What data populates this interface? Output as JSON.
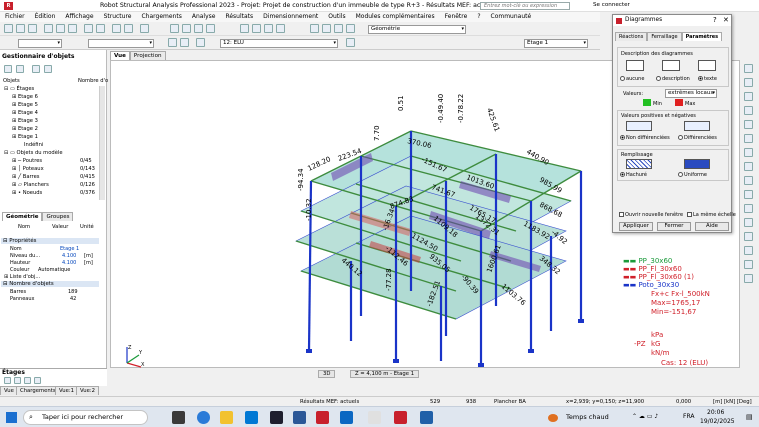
{
  "window": {
    "title": "Robot Structural Analysis Professional 2023 - Projet: Projet de construction d'un immeuble de type R+3 - Résultats MEF: actuels",
    "search_placeholder": "Entrez mot-clé ou expression",
    "sign_in": "Se connecter"
  },
  "menu": [
    "Fichier",
    "Édition",
    "Affichage",
    "Structure",
    "Chargements",
    "Analyse",
    "Résultats",
    "Dimensionnement",
    "Outils",
    "Modules complémentaires",
    "Fenêtre",
    "?",
    "Communauté"
  ],
  "toolbar": {
    "load_case": "12: ELU",
    "layout": "Géométrie",
    "story": "Etage 1"
  },
  "object_inspector": {
    "title": "Gestionnaire d'objets",
    "col_objects": "Objets",
    "col_count": "Nombre d'o",
    "tree": [
      {
        "label": "Étages",
        "value": ""
      },
      {
        "label": "Etage 6",
        "value": ""
      },
      {
        "label": "Etage 5",
        "value": ""
      },
      {
        "label": "Etage 4",
        "value": ""
      },
      {
        "label": "Etage 3",
        "value": ""
      },
      {
        "label": "Etage 2",
        "value": ""
      },
      {
        "label": "Etage 1",
        "value": ""
      },
      {
        "label": "Indéfini",
        "value": ""
      },
      {
        "label": "Objets du modèle",
        "value": ""
      },
      {
        "label": "Poutres",
        "value": "0/45"
      },
      {
        "label": "Poteaux",
        "value": "0/143"
      },
      {
        "label": "Barres",
        "value": "0/415"
      },
      {
        "label": "Planchers",
        "value": "0/126"
      },
      {
        "label": "Noeuds",
        "value": "0/376"
      }
    ]
  },
  "properties": {
    "tabs": [
      "Géométrie",
      "Groupes"
    ],
    "headers": [
      "Nom",
      "Valeur",
      "Unité"
    ],
    "section_props": "Propriétés",
    "rows": [
      {
        "name": "Nom",
        "value": "Etage 1",
        "unit": ""
      },
      {
        "name": "Niveau du...",
        "value": "4.100",
        "unit": "[m]"
      },
      {
        "name": "Hauteur",
        "value": "4.100",
        "unit": "[m]"
      },
      {
        "name": "Couleur",
        "value": "Automatique",
        "unit": ""
      },
      {
        "name": "Liste d'obj...",
        "value": "",
        "unit": ""
      }
    ],
    "section_count": "Nombre d'objets",
    "count_rows": [
      {
        "name": "Barres",
        "value": "189"
      },
      {
        "name": "Panneaux",
        "value": "42"
      }
    ]
  },
  "etages_panel": "Étages",
  "view_tabs": [
    "Vue",
    "Projection"
  ],
  "diagram_labels": [
    "0.51",
    "-0.49.40",
    "-0.78.22",
    "7.70",
    "370.06",
    "425.61",
    "-151.67",
    "1013.60",
    "440.90",
    "223.54",
    "1765.17",
    "985.99",
    "128.20",
    "741.67",
    "874.83",
    "868.68",
    "-10.32",
    "1109.18",
    "1372.31",
    "-16.34",
    "1124.50",
    "1183.92",
    "-112.46",
    "935.05",
    "1600.61",
    "348.32",
    "440.12",
    "-94.34",
    "-77.28",
    "-182.51",
    "-90.39",
    "1103.76",
    "-4.92"
  ],
  "legend": {
    "items": [
      {
        "label": "PP_30x60",
        "color": "#1a9a3a"
      },
      {
        "label": "PP_Fl_30x60",
        "color": "#d0202a"
      },
      {
        "label": "PP_Fl_30x60 (1)",
        "color": "#d0202a"
      },
      {
        "label": "Poto_30x30",
        "color": "#1a34c8"
      }
    ],
    "diagram": "Fx+c Fx-l_500kN",
    "max": "Max=1765,17",
    "min": "Min=-151,67",
    "units": [
      "kPa",
      "kG",
      "kN/m"
    ],
    "pz": "-PZ",
    "case": "Cas: 12 (ELU)"
  },
  "viewport_bottom": {
    "mode": "3D",
    "level": "Z = 4,100 m - Etage 1"
  },
  "dialog": {
    "title": "Diagrammes",
    "tabs": [
      "Réactions",
      "Ferraillage",
      "Paramètres"
    ],
    "group_desc": "Description des diagrammes",
    "desc_options": [
      "aucune",
      "description",
      "texte"
    ],
    "values_label": "Valeurs:",
    "values_select": "extrêmes locaux",
    "min_label": "Min",
    "max_label": "Max",
    "group_posneg": "Valeurs positives et négatives",
    "posneg_options": [
      "Non différenciées",
      "Différenciées"
    ],
    "group_fill": "Remplissage",
    "fill_options": [
      "Hachuré",
      "Uniforme"
    ],
    "open_new": "Ouvrir nouvelle fenêtre",
    "same_scale": "La même échelle",
    "btn_apply": "Appliquer",
    "btn_close": "Fermer",
    "btn_help": "Aide"
  },
  "bottom_tabs": [
    "Vue",
    "Chargements",
    "Vue:1",
    "Vue:2"
  ],
  "status": {
    "results": "Résultats MEF: actuels",
    "nodes": "529",
    "bars": "938",
    "element": "Plancher BA",
    "coords": "x=2,939; y=0,150; z=11,900",
    "value": "0,000",
    "units": "[m] [kN] [Deg]"
  },
  "taskbar": {
    "search": "Taper ici pour rechercher",
    "weather": "Temps chaud",
    "lang": "FRA",
    "time": "20:06",
    "date": "19/02/2025"
  },
  "colors": {
    "accent": "#2a6ecb",
    "frame": "#1a34c8",
    "slab": "#9fd8d0",
    "beam": "#4a9a4a"
  }
}
